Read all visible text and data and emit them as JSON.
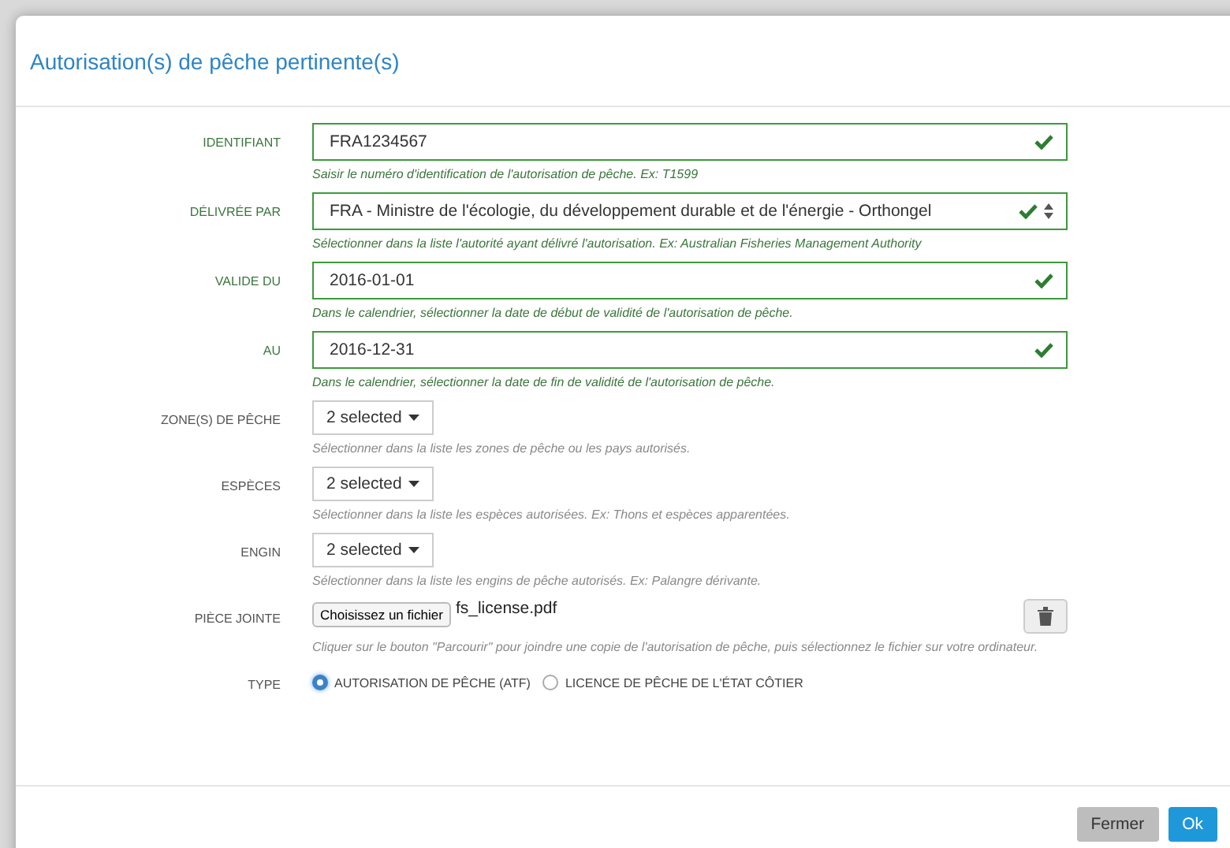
{
  "dialog": {
    "title": "Autorisation(s) de pêche pertinente(s)"
  },
  "fields": [
    {
      "kind": "text",
      "label": "IDENTIFIANT",
      "value": "FRA1234567",
      "valid": true,
      "help": "Saisir le numéro d'identification de l'autorisation de pêche. Ex: T1599"
    },
    {
      "kind": "select",
      "label": "DÉLIVRÉE PAR",
      "value": "FRA - Ministre de l'écologie, du développement durable et de l'énergie - Orthongel",
      "valid": true,
      "help": "Sélectionner dans la liste l'autorité ayant délivré l'autorisation. Ex: Australian Fisheries Management Authority"
    },
    {
      "kind": "text",
      "label": "VALIDE DU",
      "value": "2016-01-01",
      "valid": true,
      "help": "Dans le calendrier, sélectionner la date de début de validité de l'autorisation de pêche."
    },
    {
      "kind": "text",
      "label": "AU",
      "value": "2016-12-31",
      "valid": true,
      "help": "Dans le calendrier, sélectionner la date de fin de validité de l'autorisation de pêche."
    },
    {
      "kind": "multiselect",
      "label": "ZONE(S) DE PÊCHE",
      "value": "2 selected",
      "help": "Sélectionner dans la liste les zones de pêche ou les pays autorisés."
    },
    {
      "kind": "multiselect",
      "label": "ESPÈCES",
      "value": "2 selected",
      "help": "Sélectionner dans la liste les espèces autorisées. Ex: Thons et espèces apparentées."
    },
    {
      "kind": "multiselect",
      "label": "ENGIN",
      "value": "2 selected",
      "help": "Sélectionner dans la liste les engins de pêche autorisés. Ex: Palangre dérivante."
    },
    {
      "kind": "file",
      "label": "PIÈCE JOINTE",
      "button": "Choisissez un fichier",
      "value": "fs_license.pdf",
      "help": "Cliquer sur le bouton \"Parcourir\" pour joindre une copie de l'autorisation de pêche, puis sélectionnez le fichier sur votre ordinateur."
    },
    {
      "kind": "radio",
      "label": "TYPE",
      "options": [
        {
          "label": "AUTORISATION DE PÊCHE (ATF)",
          "selected": true
        },
        {
          "label": "LICENCE DE PÊCHE DE L'ÉTAT CÔTIER",
          "selected": false
        }
      ]
    }
  ],
  "buttons": [
    {
      "label": "Fermer",
      "kind": "default"
    },
    {
      "label": "Ok",
      "kind": "primary"
    }
  ]
}
